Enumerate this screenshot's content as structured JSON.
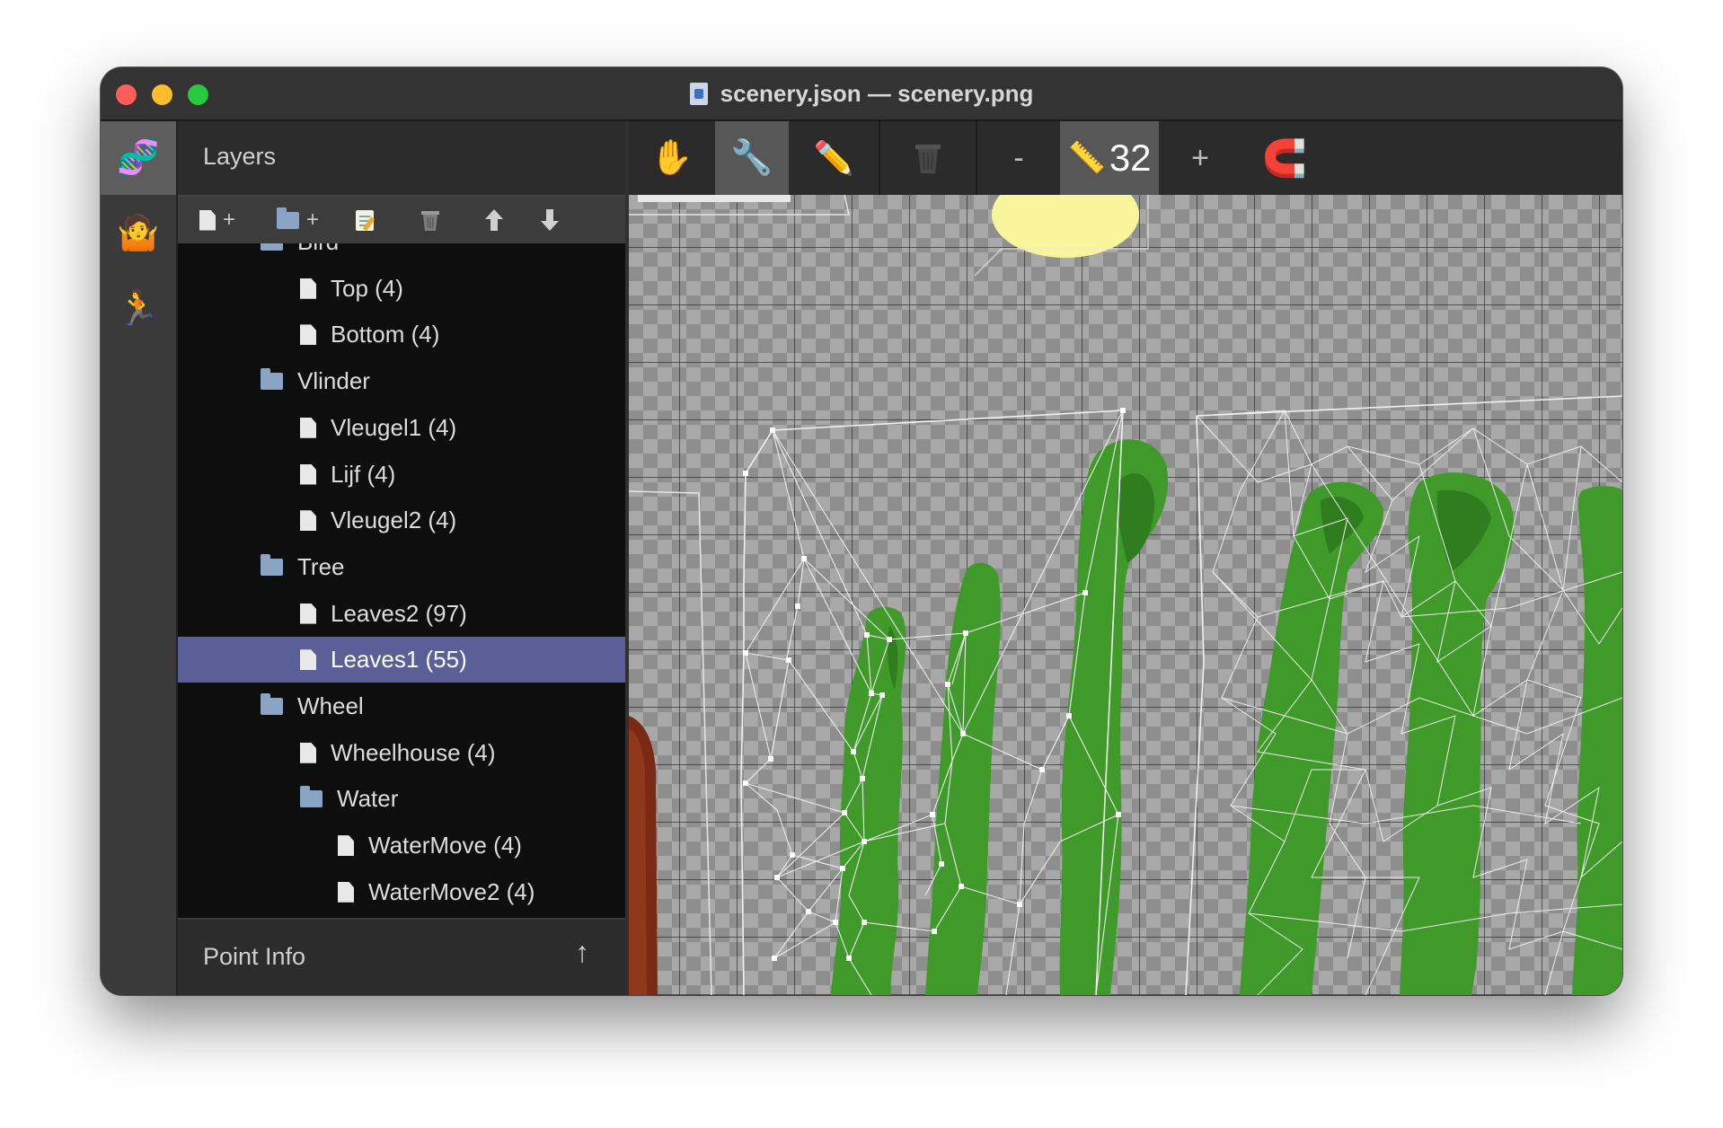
{
  "window": {
    "title": "scenery.json — scenery.png"
  },
  "mode_bar": {
    "items": [
      {
        "icon": "dna-icon",
        "glyph": "🧬"
      },
      {
        "icon": "person-shrugging-icon",
        "glyph": "🤷"
      },
      {
        "icon": "person-running-icon",
        "glyph": "🏃"
      }
    ]
  },
  "layers_panel": {
    "title": "Layers",
    "toolbar": {
      "add_layer_plus": "+",
      "add_folder_plus": "+"
    },
    "rows": [
      {
        "label": "Bird",
        "type": "folder",
        "depth": 1
      },
      {
        "label": "Top (4)",
        "type": "layer",
        "depth": 2
      },
      {
        "label": "Bottom (4)",
        "type": "layer",
        "depth": 2
      },
      {
        "label": "Vlinder",
        "type": "folder",
        "depth": 1
      },
      {
        "label": "Vleugel1 (4)",
        "type": "layer",
        "depth": 2
      },
      {
        "label": "Lijf (4)",
        "type": "layer",
        "depth": 2
      },
      {
        "label": "Vleugel2 (4)",
        "type": "layer",
        "depth": 2
      },
      {
        "label": "Tree",
        "type": "folder",
        "depth": 1
      },
      {
        "label": "Leaves2 (97)",
        "type": "layer",
        "depth": 2
      },
      {
        "label": "Leaves1 (55)",
        "type": "layer",
        "depth": 2,
        "selected": true
      },
      {
        "label": "Wheel",
        "type": "folder",
        "depth": 1
      },
      {
        "label": "Wheelhouse (4)",
        "type": "layer",
        "depth": 2
      },
      {
        "label": "Water",
        "type": "folder",
        "depth": 2
      },
      {
        "label": "WaterMove (4)",
        "type": "layer",
        "depth": 3
      },
      {
        "label": "WaterMove2 (4)",
        "type": "layer",
        "depth": 3
      }
    ]
  },
  "point_info": {
    "label": "Point Info",
    "arrow": "↑"
  },
  "canvas_toolbar": {
    "hand": "✋",
    "wrench": "🔧",
    "pencil": "✏️",
    "trash": "🗑",
    "zoom_out": "-",
    "ruler": "📏",
    "grid_size": "32",
    "zoom_in": "+",
    "magnet": "🧲"
  },
  "colors": {
    "selection": "#5b5f97",
    "leaf_green": "#3f9a2a",
    "leaf_dark": "#2f7d1e",
    "sun": "#f8f59a",
    "trunk": "#7a2a14"
  }
}
